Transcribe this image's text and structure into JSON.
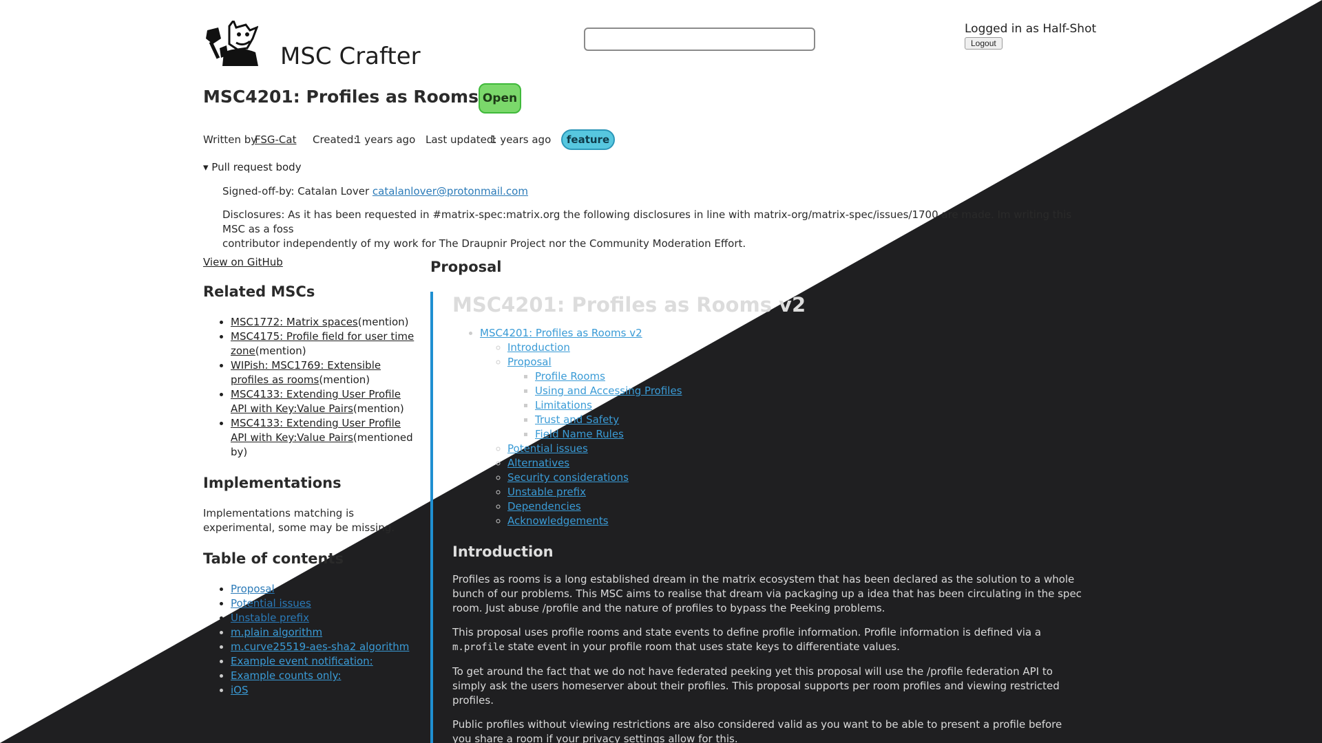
{
  "header": {
    "site_title": "MSC Crafter",
    "search_placeholder": "",
    "logged_in_text": "Logged in as Half-Shot",
    "logout_label": "Logout"
  },
  "msc": {
    "title": "MSC4201: Profiles as Rooms v2",
    "status": "Open",
    "written_by_label": "Written by",
    "author": "FSG-Cat",
    "created_label": "Created:",
    "created_value": "1 years ago",
    "updated_label": "Last updated:",
    "updated_value": "1 years ago",
    "label_tag": "feature"
  },
  "pull_request": {
    "toggle_label": "▾ Pull request body",
    "signoff_text": "Signed-off-by: Catalan Lover",
    "signoff_email": "catalanlover@protonmail.com",
    "disclosures_line1": "Disclosures: As it has been requested in #matrix-spec:matrix.org the following disclosures in line with matrix-org/matrix-spec/issues/1700 are made. Im writing this MSC as a foss",
    "disclosures_line2": "contributor independently of my work for The Draupnir Project nor the Community Moderation Effort."
  },
  "sidebar": {
    "github_link": "View on GitHub",
    "related_heading": "Related MSCs",
    "related": [
      {
        "title": "MSC1772: Matrix spaces",
        "suffix": "(mention)"
      },
      {
        "title": "MSC4175: Profile field for user time zone",
        "suffix": "(mention)"
      },
      {
        "title": "WIPish: MSC1769: Extensible profiles as rooms",
        "suffix": "(mention)"
      },
      {
        "title": "MSC4133: Extending User Profile API with Key:Value Pairs",
        "suffix": "(mention)"
      },
      {
        "title": "MSC4133: Extending User Profile API with Key:Value Pairs",
        "suffix": "(mentioned by)"
      }
    ],
    "implementations_heading": "Implementations",
    "implementations_note": "Implementations matching is experimental, some may be missing.",
    "toc_heading": "Table of contents",
    "toc": [
      "Proposal",
      "Potential issues",
      "Unstable prefix",
      "m.plain algorithm",
      "m.curve25519-aes-sha2 algorithm",
      "Example event notification:",
      "Example counts only:",
      "iOS"
    ]
  },
  "main": {
    "proposal_label": "Proposal",
    "doc_title": "MSC4201: Profiles as Rooms v2",
    "toc_root": "MSC4201: Profiles as Rooms v2",
    "toc_intro": "Introduction",
    "toc_proposal": "Proposal",
    "toc_proposal_children": [
      "Profile Rooms",
      "Using and Accessing Profiles",
      "Limitations",
      "Trust and Safety",
      "Field Name Rules"
    ],
    "toc_rest": [
      "Potential issues",
      "Alternatives",
      "Security considerations",
      "Unstable prefix",
      "Dependencies",
      "Acknowledgements"
    ],
    "intro_heading": "Introduction",
    "p1": "Profiles as rooms is a long established dream in the matrix ecosystem that has been declared as the solution to a whole bunch of our problems. This MSC aims to realise that dream via packaging up a idea that has been circulating in the spec room. Just abuse /profile and the nature of profiles to bypass the Peeking problems.",
    "p2_before": "This proposal uses profile rooms and state events to define profile information. Profile information is defined via a ",
    "p2_code": "m.profile",
    "p2_after": " state event in your profile room that uses state keys to differentiate values.",
    "p3": "To get around the fact that we do not have federated peeking yet this proposal will use the /profile federation API to simply ask the users homeserver about their profiles. This proposal supports per room profiles and viewing restricted profiles.",
    "p4": "Public profiles without viewing restrictions are also considered valid as you want to be able to present a profile before you share a room if your privacy settings allow for this."
  }
}
